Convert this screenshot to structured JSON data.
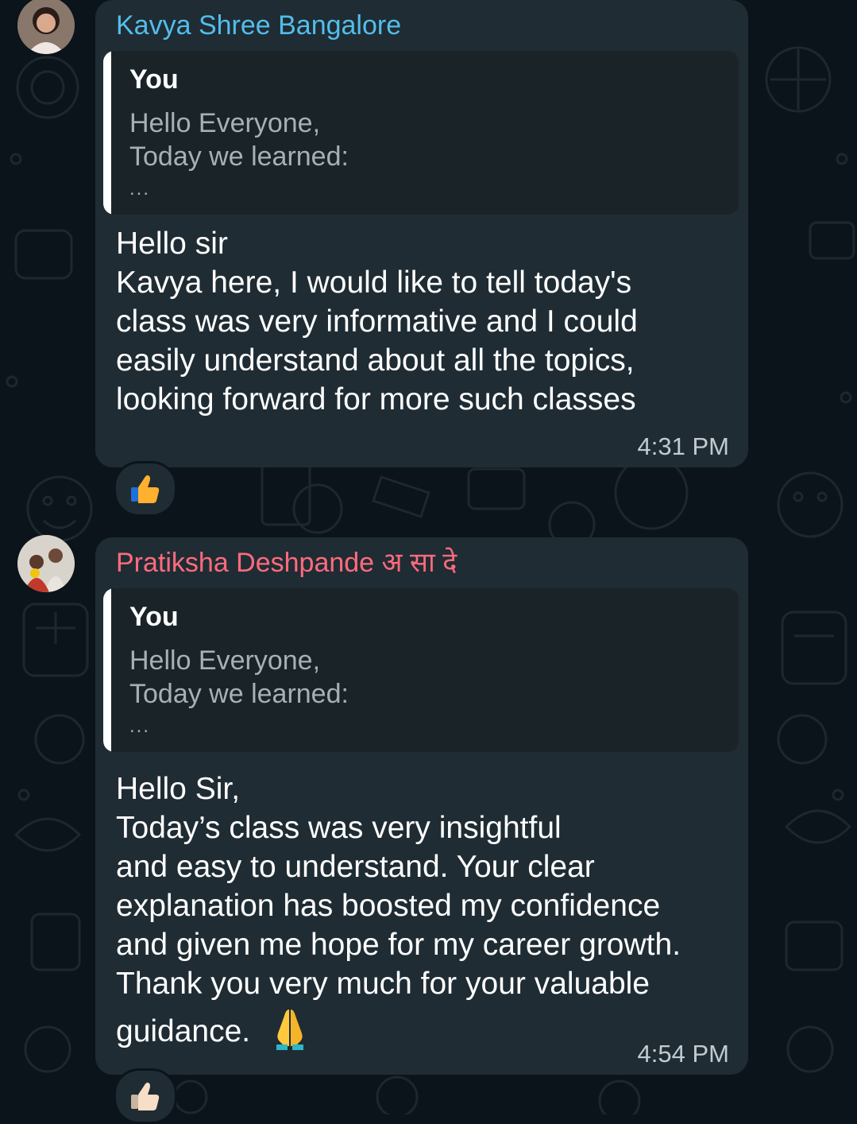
{
  "messages": [
    {
      "sender": "Kavya Shree Bangalore",
      "sender_color": "#53bdeb",
      "quoted": {
        "author": "You",
        "lines": [
          "Hello Everyone,",
          "Today we learned:",
          "..."
        ]
      },
      "body_lines": [
        "Hello sir",
        "Kavya here, I would like to tell today's",
        "class was very informative and I could",
        "easily understand about all the topics,",
        "looking forward for more such classes"
      ],
      "time": "4:31 PM",
      "reaction": "thumbs-up-icon"
    },
    {
      "sender": "Pratiksha Deshpande अ सा दे",
      "sender_color": "#ff6b7d",
      "quoted": {
        "author": "You",
        "lines": [
          "Hello Everyone,",
          "Today we learned:",
          "..."
        ]
      },
      "body_lines": [
        "Hello Sir,",
        "Today’s class was very insightful",
        "and easy to understand. Your clear",
        "explanation has boosted my confidence",
        "and given me hope for my career growth.",
        "Thank you very much for your valuable",
        "guidance."
      ],
      "body_emoji": "folded-hands-icon",
      "time": "4:54 PM",
      "reaction": "thumbs-up-light-skin-icon"
    }
  ],
  "colors": {
    "background": "#0b141a",
    "bubble": "#1f2c33",
    "quote_background": "#1a2328",
    "quote_text": "#a6b0b5",
    "timestamp": "#c3cbcf"
  }
}
